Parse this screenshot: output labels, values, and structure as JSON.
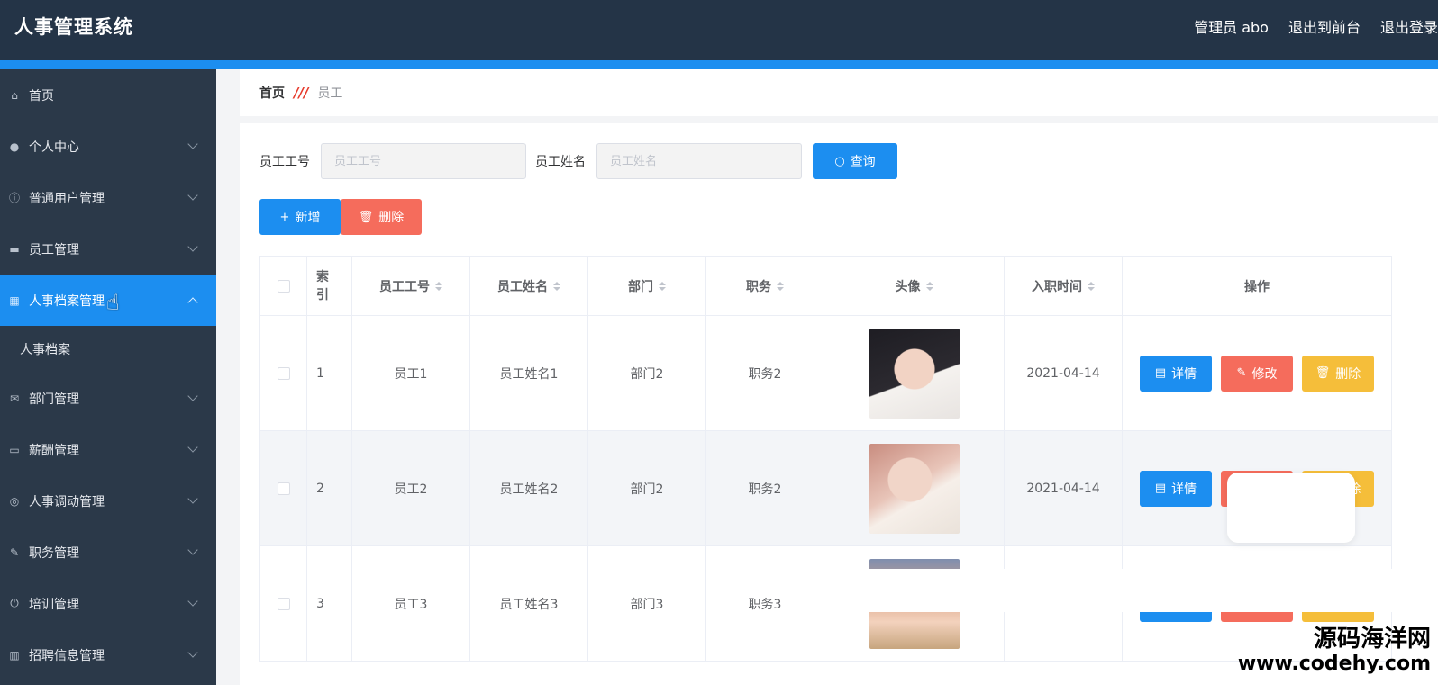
{
  "header": {
    "app_title": "人事管理系统",
    "user_label": "管理员 abo",
    "frontend_link": "退出到前台",
    "logout_link": "退出登录"
  },
  "sidebar": {
    "items": [
      {
        "label": "首页",
        "icon": "home-icon",
        "chevron": false
      },
      {
        "label": "个人中心",
        "icon": "user-icon",
        "chevron": true
      },
      {
        "label": "普通用户管理",
        "icon": "info-circle-icon",
        "chevron": true
      },
      {
        "label": "员工管理",
        "icon": "monitor-icon",
        "chevron": true
      },
      {
        "label": "人事档案管理",
        "icon": "grid-icon",
        "chevron": true,
        "active": true
      },
      {
        "label": "部门管理",
        "icon": "mail-icon",
        "chevron": true
      },
      {
        "label": "薪酬管理",
        "icon": "wallet-icon",
        "chevron": true
      },
      {
        "label": "人事调动管理",
        "icon": "globe-icon",
        "chevron": true
      },
      {
        "label": "职务管理",
        "icon": "edit-icon",
        "chevron": true
      },
      {
        "label": "培训管理",
        "icon": "power-icon",
        "chevron": true
      },
      {
        "label": "招聘信息管理",
        "icon": "trash-icon",
        "chevron": true
      }
    ],
    "submenu": {
      "label": "人事档案"
    }
  },
  "breadcrumb": {
    "home": "首页",
    "separator": "///",
    "current": "员工"
  },
  "search": {
    "no_label": "员工工号",
    "no_placeholder": "员工工号",
    "name_label": "员工姓名",
    "name_placeholder": "员工姓名",
    "query_button": "查询"
  },
  "actions": {
    "add_button": "新增",
    "delete_button": "删除"
  },
  "table": {
    "headers": {
      "index": "索引",
      "employee_no": "员工工号",
      "employee_name": "员工姓名",
      "department": "部门",
      "position": "职务",
      "avatar": "头像",
      "hire_date": "入职时间",
      "operations": "操作"
    },
    "rows": [
      {
        "index": "1",
        "employee_no": "员工1",
        "employee_name": "员工姓名1",
        "department": "部门2",
        "position": "职务2",
        "hire_date": "2021-04-14"
      },
      {
        "index": "2",
        "employee_no": "员工2",
        "employee_name": "员工姓名2",
        "department": "部门2",
        "position": "职务2",
        "hire_date": "2021-04-14"
      },
      {
        "index": "3",
        "employee_no": "员工3",
        "employee_name": "员工姓名3",
        "department": "部门3",
        "position": "职务3",
        "hire_date": ""
      }
    ],
    "row_buttons": {
      "detail": "详情",
      "edit": "修改",
      "delete": "删除"
    }
  },
  "watermark": {
    "line1": "源码海洋网",
    "line2": "www.codehy.com"
  },
  "colors": {
    "header_bg": "#243447",
    "sidebar_bg": "#2b3949",
    "accent": "#1c8ef0",
    "danger": "#f56c5c",
    "warning": "#f5be3a"
  }
}
